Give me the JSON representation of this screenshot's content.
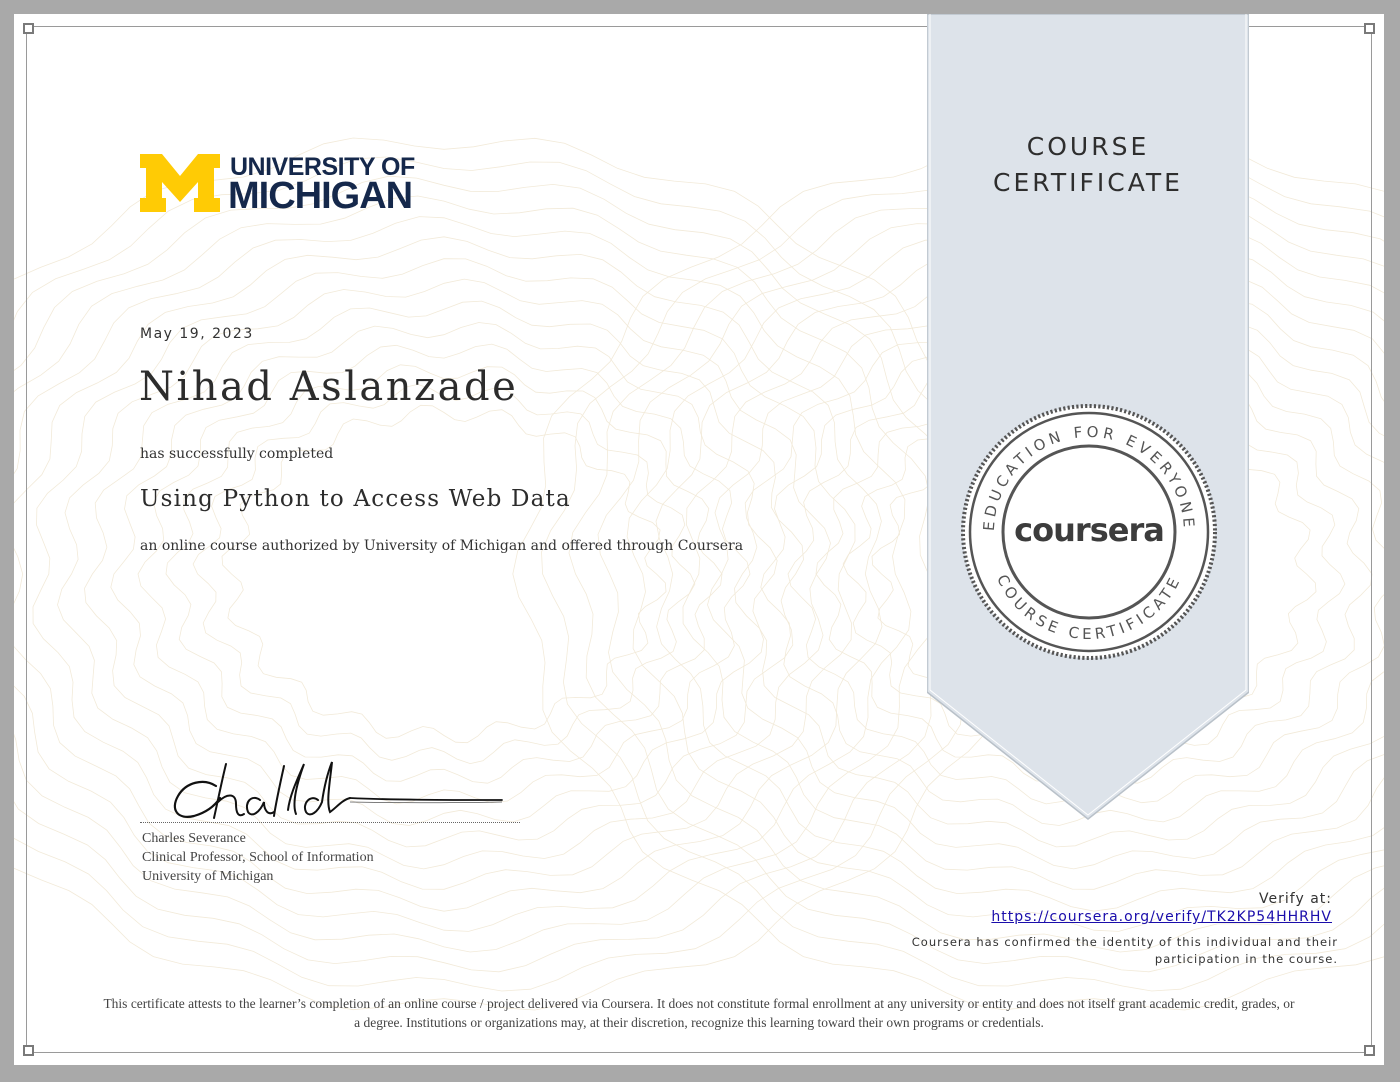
{
  "logo": {
    "line1": "UNIVERSITY OF",
    "line2": "MICHIGAN",
    "mark": "M",
    "colors": {
      "maize": "#FFCB05",
      "blue": "#15284B"
    }
  },
  "certificate": {
    "date": "May 19, 2023",
    "recipient": "Nihad Aslanzade",
    "completion_text": "has successfully completed",
    "course_title": "Using Python to Access Web Data",
    "authorization_text": "an online course authorized by University of Michigan and offered through Coursera"
  },
  "signer": {
    "name": "Charles Severance",
    "title": "Clinical Professor, School of Information",
    "institution": "University of Michigan",
    "signature_icon": "handwritten-signature"
  },
  "ribbon": {
    "line1": "COURSE",
    "line2": "CERTIFICATE",
    "color": "#DDE3EA"
  },
  "seal": {
    "brand": "coursera",
    "top_arc": "EDUCATION FOR EVERYONE",
    "bottom_arc": "COURSE CERTIFICATE",
    "color": "#555555"
  },
  "verify": {
    "label": "Verify at:",
    "url": "https://coursera.org/verify/TK2KP54HHRHV",
    "confirm_line1": "Coursera has confirmed the identity of this individual and their",
    "confirm_line2": "participation in the course."
  },
  "footer": {
    "line1": "This certificate attests to the learner’s completion of an online course / project delivered via Coursera. It does not constitute formal enrollment at any university or entity and does not itself grant academic credit, grades, or",
    "line2": "a degree. Institutions or organizations may, at their discretion, recognize this learning toward their own programs or credentials."
  }
}
